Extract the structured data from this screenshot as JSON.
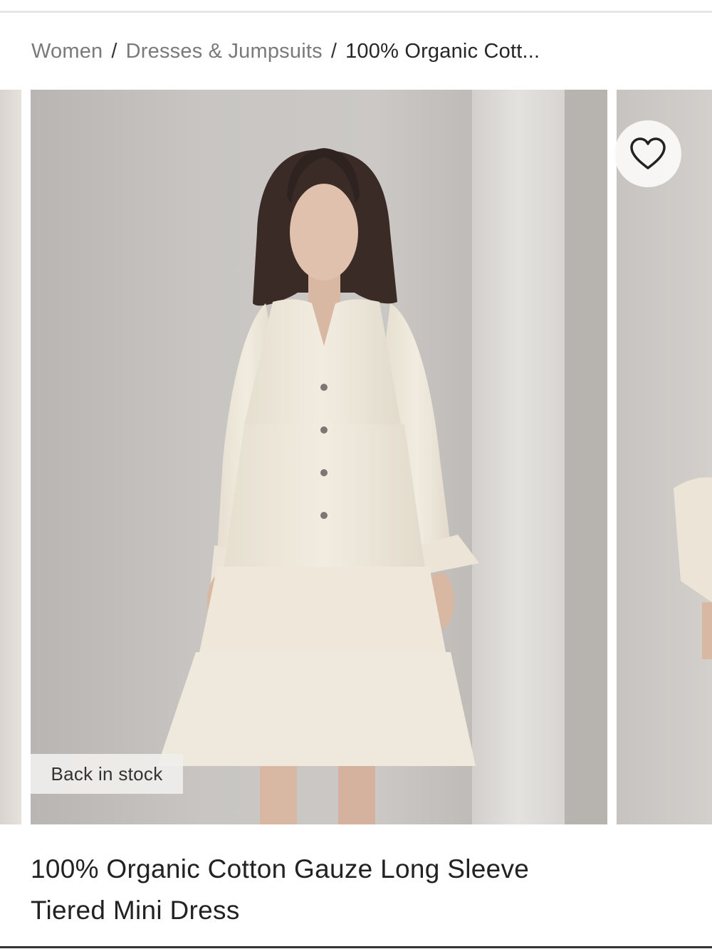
{
  "breadcrumb": {
    "items": [
      {
        "label": "Women"
      },
      {
        "label": "Dresses & Jumpsuits"
      }
    ],
    "separator": "/",
    "current": "100% Organic Cott..."
  },
  "gallery": {
    "badge": "Back in stock",
    "wishlist_icon": "heart-icon"
  },
  "product": {
    "title_line1": "100% Organic Cotton Gauze Long Sleeve",
    "title_line2": "Tiered Mini Dress"
  },
  "colors": {
    "text_primary": "#222222",
    "text_muted": "#7a7a7a",
    "dress": "#efe8da",
    "wall": "#c8c5c2"
  }
}
